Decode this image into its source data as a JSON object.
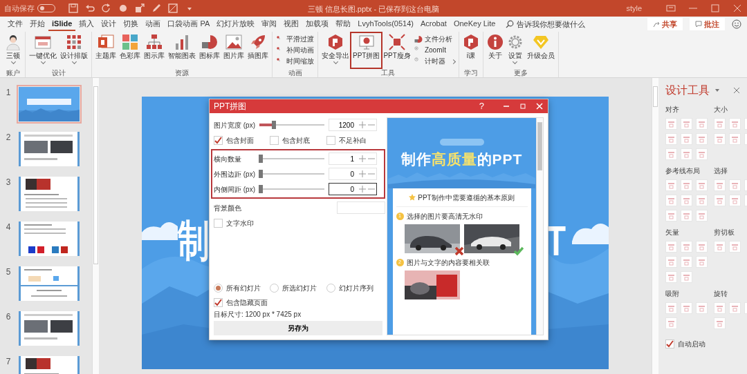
{
  "title_bar": {
    "autosave": {
      "label": "自动保存",
      "on": false
    },
    "title": "三顿 信息长图.pptx  -  已保存到这台电脑",
    "user": "style"
  },
  "tabs": [
    {
      "label": "文件",
      "selected": false
    },
    {
      "label": "开始",
      "selected": false
    },
    {
      "label": "iSlide",
      "selected": true
    },
    {
      "label": "插入",
      "selected": false
    },
    {
      "label": "设计",
      "selected": false
    },
    {
      "label": "切换",
      "selected": false
    },
    {
      "label": "动画",
      "selected": false
    },
    {
      "label": "口袋动画 PA",
      "selected": false
    },
    {
      "label": "幻灯片放映",
      "selected": false
    },
    {
      "label": "审阅",
      "selected": false
    },
    {
      "label": "视图",
      "selected": false
    },
    {
      "label": "加载项",
      "selected": false
    },
    {
      "label": "帮助",
      "selected": false
    },
    {
      "label": "LvyhTools(0514)",
      "selected": false
    },
    {
      "label": "Acrobat",
      "selected": false
    },
    {
      "label": "OneKey Lite",
      "selected": false
    }
  ],
  "search": {
    "placeholder": "告诉我你想要做什么"
  },
  "share_button": "共享",
  "comment_button": "批注",
  "ribbon": [
    {
      "label": "账户",
      "items": [
        {
          "kind": "large",
          "label": "三顿",
          "dropdown": true,
          "highlighted": false
        }
      ]
    },
    {
      "label": "设计",
      "items": [
        {
          "kind": "large",
          "label": "一键优化",
          "dropdown": true,
          "highlighted": false
        },
        {
          "kind": "large",
          "label": "设计排版",
          "dropdown": true,
          "highlighted": false
        }
      ]
    },
    {
      "label": "资源",
      "items": [
        {
          "kind": "large",
          "label": "主题库",
          "dropdown": false,
          "highlighted": false
        },
        {
          "kind": "large",
          "label": "色彩库",
          "dropdown": false,
          "highlighted": false
        },
        {
          "kind": "large",
          "label": "图示库",
          "dropdown": false,
          "highlighted": false
        },
        {
          "kind": "large",
          "label": "智能图表",
          "dropdown": false,
          "highlighted": false
        },
        {
          "kind": "large",
          "label": "图标库",
          "dropdown": false,
          "highlighted": false
        },
        {
          "kind": "large",
          "label": "图片库",
          "dropdown": false,
          "highlighted": false
        },
        {
          "kind": "large",
          "label": "插图库",
          "dropdown": false,
          "highlighted": false
        }
      ]
    },
    {
      "label": "动画",
      "items": [
        {
          "kind": "small",
          "label": "平滑过渡",
          "dropdown": false,
          "highlighted": false
        },
        {
          "kind": "small",
          "label": "补间动画",
          "dropdown": false,
          "highlighted": false
        },
        {
          "kind": "small",
          "label": "时间缩放",
          "dropdown": false,
          "highlighted": false
        }
      ]
    },
    {
      "label": "工具",
      "items": [
        {
          "kind": "large",
          "label": "安全导出",
          "dropdown": true,
          "highlighted": false
        },
        {
          "kind": "large",
          "label": "PPT拼图",
          "dropdown": false,
          "highlighted": true
        },
        {
          "kind": "large",
          "label": "PPT瘦身",
          "dropdown": false,
          "highlighted": false
        },
        {
          "kind": "small",
          "label": "文件分析",
          "dropdown": false,
          "highlighted": false
        },
        {
          "kind": "small",
          "label": "ZoomIt",
          "dropdown": false,
          "highlighted": false
        },
        {
          "kind": "small",
          "label": "计时器",
          "dropdown": true,
          "highlighted": false
        }
      ]
    },
    {
      "label": "学习",
      "items": [
        {
          "kind": "large",
          "label": "i课",
          "dropdown": false,
          "highlighted": false
        }
      ]
    },
    {
      "label": "更多",
      "items": [
        {
          "kind": "large",
          "label": "关于",
          "dropdown": false,
          "highlighted": false
        },
        {
          "kind": "large",
          "label": "设置",
          "dropdown": true,
          "highlighted": false
        },
        {
          "kind": "large",
          "label": "升级会员",
          "dropdown": false,
          "highlighted": false
        }
      ]
    }
  ],
  "slides": [
    {
      "number": "1",
      "kind": "cover",
      "selected": true
    },
    {
      "number": "2",
      "kind": "photos",
      "selected": false
    },
    {
      "number": "3",
      "kind": "table",
      "selected": false
    },
    {
      "number": "4",
      "kind": "colors",
      "selected": false
    },
    {
      "number": "5",
      "kind": "split",
      "selected": false
    },
    {
      "number": "6",
      "kind": "photos",
      "selected": false
    },
    {
      "number": "7",
      "kind": "table",
      "selected": false
    }
  ],
  "slide": {
    "left_text": "制",
    "right_text": "T"
  },
  "dialog": {
    "title": "PPT拼图",
    "help": "?",
    "width": {
      "label": "图片宽度 (px)",
      "level": 0.2,
      "value": "1200",
      "focused": false
    },
    "options": [
      {
        "label": "包含封面",
        "checked": true
      },
      {
        "label": "包含封底",
        "checked": false
      },
      {
        "label": "不足补白",
        "checked": false
      }
    ],
    "layout": {
      "highlighted": true,
      "rows": [
        {
          "label": "横向数量",
          "level": 0,
          "value": "1",
          "focused": false
        },
        {
          "label": "外围边距 (px)",
          "level": 0,
          "value": "0",
          "focused": false
        },
        {
          "label": "内侧间距 (px)",
          "level": 0,
          "value": "0",
          "focused": true
        }
      ]
    },
    "background": {
      "label": "背景颜色"
    },
    "watermark": {
      "label": "文字水印",
      "checked": false
    },
    "ranges": [
      {
        "label": "所有幻灯片",
        "selected": true
      },
      {
        "label": "所选幻灯片",
        "selected": false
      },
      {
        "label": "幻灯片序列",
        "selected": false
      }
    ],
    "include_hidden": {
      "label": "包含隐藏页面",
      "checked": true
    },
    "target_size": "目标尺寸:  1200 px *  7425 px",
    "save_button": "另存为",
    "preview": {
      "title_parts": [
        {
          "text": "制作",
          "highlight": false
        },
        {
          "text": "高质量",
          "highlight": true
        },
        {
          "text": "的PPT",
          "highlight": false
        }
      ],
      "heading": "PPT制作中需要遵循的基本原则",
      "points": [
        {
          "number": "1",
          "text": "选择的图片要高清无水印",
          "photos": [
            {
              "crossed": true,
              "checked": false
            },
            {
              "crossed": false,
              "checked": true
            }
          ]
        },
        {
          "number": "2",
          "text": "图片与文字的内容要相关联",
          "photos": [
            {
              "crossed": false,
              "checked": false
            }
          ]
        }
      ]
    }
  },
  "design_tools": {
    "title": "设计工具",
    "sections": [
      {
        "label": "对齐"
      },
      {
        "label": "大小"
      },
      {
        "label": "参考线布局"
      },
      {
        "label": "选择"
      },
      {
        "label": "矢量"
      },
      {
        "label": "剪切板"
      },
      {
        "label": "吸附"
      },
      {
        "label": "旋转"
      }
    ],
    "auto_start": {
      "label": "自动启动",
      "checked": true
    }
  }
}
